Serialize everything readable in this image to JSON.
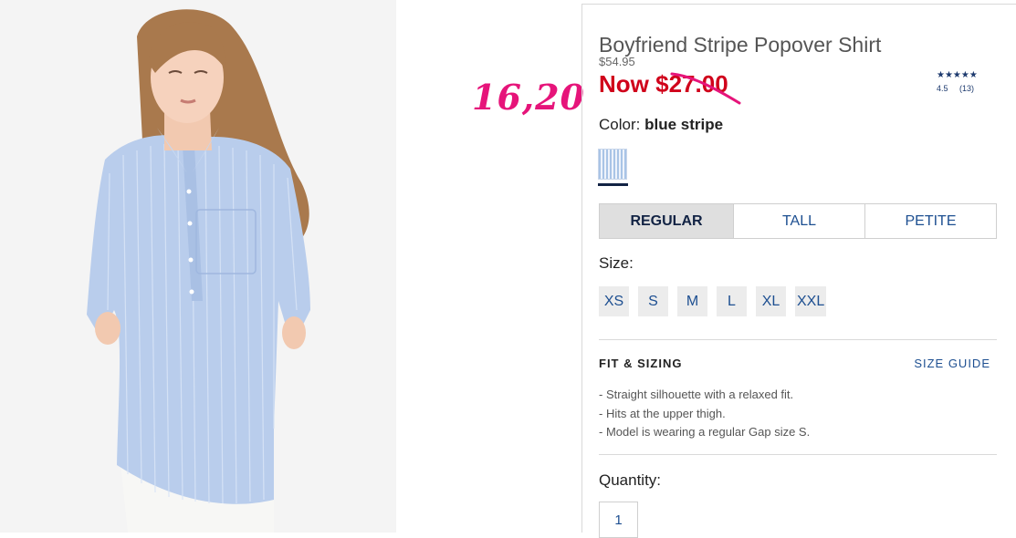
{
  "annotation": {
    "handwritten_price": "16,20"
  },
  "product": {
    "title": "Boyfriend Stripe Popover Shirt",
    "original_price": "$54.95",
    "now_label": "Now",
    "now_price": "$27.00",
    "rating": {
      "stars": "★★★★★",
      "score": "4.5",
      "reviews": "(13)"
    },
    "color_label": "Color:",
    "color_value": "blue stripe",
    "fit_tabs": [
      {
        "label": "REGULAR",
        "selected": true
      },
      {
        "label": "TALL",
        "selected": false
      },
      {
        "label": "PETITE",
        "selected": false
      }
    ],
    "size_label": "Size:",
    "sizes": [
      "XS",
      "S",
      "M",
      "L",
      "XL",
      "XXL"
    ],
    "fit_heading": "FIT & SIZING",
    "size_guide_link": "SIZE GUIDE",
    "details": [
      "- Straight silhouette with a relaxed fit.",
      "- Hits at the upper thigh.",
      "- Model is wearing a regular Gap size S."
    ],
    "quantity_label": "Quantity:",
    "quantity_value": "1"
  },
  "colors": {
    "sale": "#d0021b",
    "link": "#1d4f91",
    "annotation": "#e6147a",
    "swatch": "#a9c4e6"
  }
}
